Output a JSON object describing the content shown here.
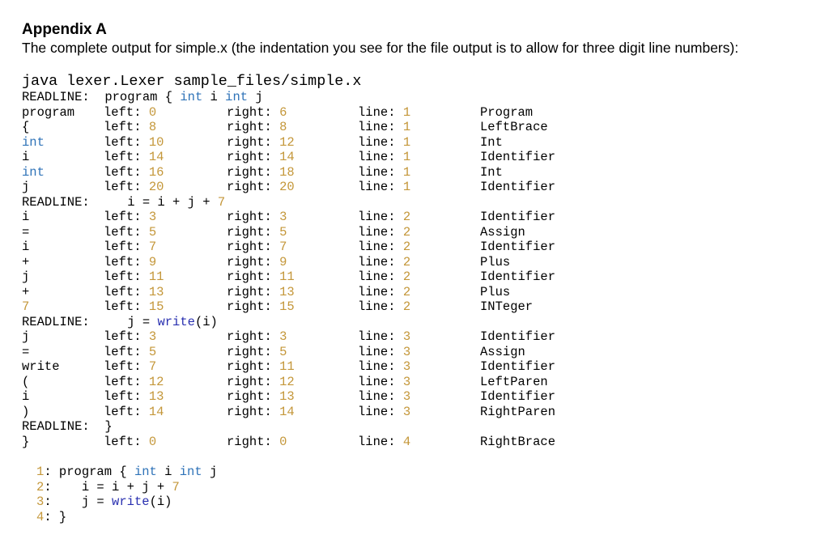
{
  "heading": "Appendix A",
  "intro": "The complete output for simple.x (the indentation you see for the file output is to allow for three digit line numbers):",
  "command": "java lexer.Lexer sample_files/simple.x",
  "labels": {
    "readline": "READLINE:",
    "left": "left: ",
    "right": "right: ",
    "line": "line: "
  },
  "colors": {
    "number": "#c4973a",
    "keyword": "#2f73b8",
    "function": "#2930b0"
  },
  "readlines": [
    {
      "segments": [
        {
          "text": "  program { ",
          "kind": "plain"
        },
        {
          "text": "int",
          "kind": "kw"
        },
        {
          "text": " i ",
          "kind": "plain"
        },
        {
          "text": "int",
          "kind": "kw"
        },
        {
          "text": " j",
          "kind": "plain"
        }
      ],
      "tokens": [
        {
          "token": "program",
          "token_kind": "plain",
          "left": "0",
          "right": "6",
          "line": "1",
          "type": "Program"
        },
        {
          "token": "{",
          "token_kind": "plain",
          "left": "8",
          "right": "8",
          "line": "1",
          "type": "LeftBrace"
        },
        {
          "token": "int",
          "token_kind": "kw",
          "left": "10",
          "right": "12",
          "line": "1",
          "type": "Int"
        },
        {
          "token": "i",
          "token_kind": "plain",
          "left": "14",
          "right": "14",
          "line": "1",
          "type": "Identifier"
        },
        {
          "token": "int",
          "token_kind": "kw",
          "left": "16",
          "right": "18",
          "line": "1",
          "type": "Int"
        },
        {
          "token": "j",
          "token_kind": "plain",
          "left": "20",
          "right": "20",
          "line": "1",
          "type": "Identifier"
        }
      ]
    },
    {
      "segments": [
        {
          "text": "     i = i + j + ",
          "kind": "plain"
        },
        {
          "text": "7",
          "kind": "num"
        }
      ],
      "tokens": [
        {
          "token": "i",
          "token_kind": "plain",
          "left": "3",
          "right": "3",
          "line": "2",
          "type": "Identifier"
        },
        {
          "token": "=",
          "token_kind": "plain",
          "left": "5",
          "right": "5",
          "line": "2",
          "type": "Assign"
        },
        {
          "token": "i",
          "token_kind": "plain",
          "left": "7",
          "right": "7",
          "line": "2",
          "type": "Identifier"
        },
        {
          "token": "+",
          "token_kind": "plain",
          "left": "9",
          "right": "9",
          "line": "2",
          "type": "Plus"
        },
        {
          "token": "j",
          "token_kind": "plain",
          "left": "11",
          "right": "11",
          "line": "2",
          "type": "Identifier"
        },
        {
          "token": "+",
          "token_kind": "plain",
          "left": "13",
          "right": "13",
          "line": "2",
          "type": "Plus"
        },
        {
          "token": "7",
          "token_kind": "num",
          "left": "15",
          "right": "15",
          "line": "2",
          "type": "INTeger"
        }
      ]
    },
    {
      "segments": [
        {
          "text": "     j = ",
          "kind": "plain"
        },
        {
          "text": "write",
          "kind": "fn"
        },
        {
          "text": "(i)",
          "kind": "plain"
        }
      ],
      "tokens": [
        {
          "token": "j",
          "token_kind": "plain",
          "left": "3",
          "right": "3",
          "line": "3",
          "type": "Identifier"
        },
        {
          "token": "=",
          "token_kind": "plain",
          "left": "5",
          "right": "5",
          "line": "3",
          "type": "Assign"
        },
        {
          "token": "write",
          "token_kind": "plain",
          "left": "7",
          "right": "11",
          "line": "3",
          "type": "Identifier"
        },
        {
          "token": "(",
          "token_kind": "plain",
          "left": "12",
          "right": "12",
          "line": "3",
          "type": "LeftParen"
        },
        {
          "token": "i",
          "token_kind": "plain",
          "left": "13",
          "right": "13",
          "line": "3",
          "type": "Identifier"
        },
        {
          "token": ")",
          "token_kind": "plain",
          "left": "14",
          "right": "14",
          "line": "3",
          "type": "RightParen"
        }
      ]
    },
    {
      "segments": [
        {
          "text": "  }",
          "kind": "plain"
        }
      ],
      "tokens": [
        {
          "token": "}",
          "token_kind": "plain",
          "left": "0",
          "right": "0",
          "line": "4",
          "type": "RightBrace"
        }
      ]
    }
  ],
  "listing": [
    {
      "number": "1",
      "segments": [
        {
          "text": "program { ",
          "kind": "plain"
        },
        {
          "text": "int",
          "kind": "kw"
        },
        {
          "text": " i ",
          "kind": "plain"
        },
        {
          "text": "int",
          "kind": "kw"
        },
        {
          "text": " j",
          "kind": "plain"
        }
      ]
    },
    {
      "number": "2",
      "segments": [
        {
          "text": "   i = i + j + ",
          "kind": "plain"
        },
        {
          "text": "7",
          "kind": "num"
        }
      ]
    },
    {
      "number": "3",
      "segments": [
        {
          "text": "   j = ",
          "kind": "plain"
        },
        {
          "text": "write",
          "kind": "fn"
        },
        {
          "text": "(i)",
          "kind": "plain"
        }
      ]
    },
    {
      "number": "4",
      "segments": [
        {
          "text": "}",
          "kind": "plain"
        }
      ]
    }
  ]
}
